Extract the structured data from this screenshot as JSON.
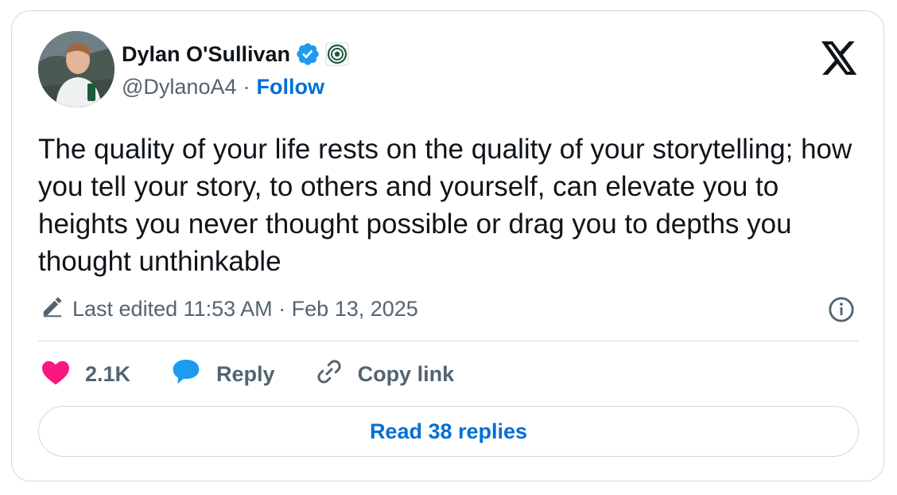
{
  "author": {
    "name": "Dylan O'Sullivan",
    "handle": "@DylanoA4",
    "separator": "·",
    "follow_label": "Follow"
  },
  "tweet": {
    "text": "The quality of your life rests on the quality of your storytelling; how you tell your story, to others and yourself, can elevate you to heights you never thought possible or drag you to depths you thought unthinkable",
    "edited_label": "Last edited 11:53 AM · Feb 13, 2025"
  },
  "actions": {
    "like_count": "2.1K",
    "reply_label": "Reply",
    "copy_link_label": "Copy link"
  },
  "read_replies_label": "Read 38 replies",
  "colors": {
    "accent": "#006fd6",
    "verified": "#1d9bf0",
    "like": "#f91880",
    "text": "#0f1419",
    "muted": "#536471",
    "border": "#cfd9de"
  },
  "icons": [
    "verified-badge-icon",
    "affiliate-badge-icon",
    "x-logo-icon",
    "pencil-icon",
    "info-icon",
    "heart-icon",
    "speech-bubble-icon",
    "link-icon"
  ]
}
